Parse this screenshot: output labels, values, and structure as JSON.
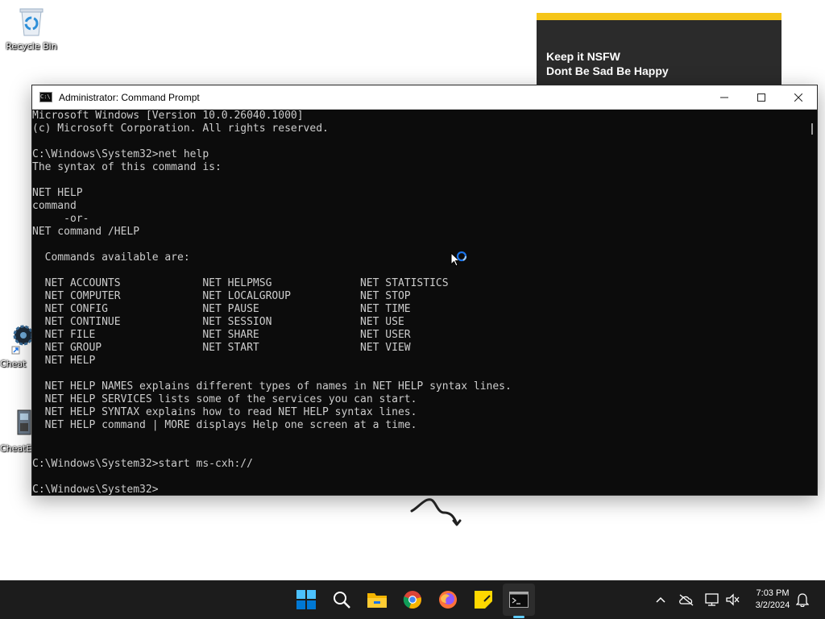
{
  "desktop": {
    "recycle_bin_label": "Recycle Bin",
    "cheat1_label": "Cheat",
    "cheat2_label": "CheatE"
  },
  "sticky_note": {
    "line1": "Keep it NSFW",
    "line2": "Dont Be Sad Be Happy"
  },
  "window": {
    "title": "Administrator: Command Prompt",
    "console_lines": [
      "Microsoft Windows [Version 10.0.26040.1000]",
      "(c) Microsoft Corporation. All rights reserved.",
      "",
      "C:\\Windows\\System32>net help",
      "The syntax of this command is:",
      "",
      "NET HELP",
      "command",
      "     -or-",
      "NET command /HELP",
      "",
      "  Commands available are:",
      "",
      "  NET ACCOUNTS             NET HELPMSG              NET STATISTICS",
      "  NET COMPUTER             NET LOCALGROUP           NET STOP",
      "  NET CONFIG               NET PAUSE                NET TIME",
      "  NET CONTINUE             NET SESSION              NET USE",
      "  NET FILE                 NET SHARE                NET USER",
      "  NET GROUP                NET START                NET VIEW",
      "  NET HELP",
      "",
      "  NET HELP NAMES explains different types of names in NET HELP syntax lines.",
      "  NET HELP SERVICES lists some of the services you can start.",
      "  NET HELP SYNTAX explains how to read NET HELP syntax lines.",
      "  NET HELP command | MORE displays Help one screen at a time.",
      "",
      "",
      "C:\\Windows\\System32>start ms-cxh://",
      "",
      "C:\\Windows\\System32>"
    ]
  },
  "taskbar": {
    "time": "7:03 PM",
    "date": "3/2/2024"
  },
  "colors": {
    "console_bg": "#0c0c0c",
    "console_text": "#cccccc",
    "sticky_accent": "#f5c518",
    "taskbar_bg": "#1c1c1c",
    "accent": "#60cdff"
  }
}
